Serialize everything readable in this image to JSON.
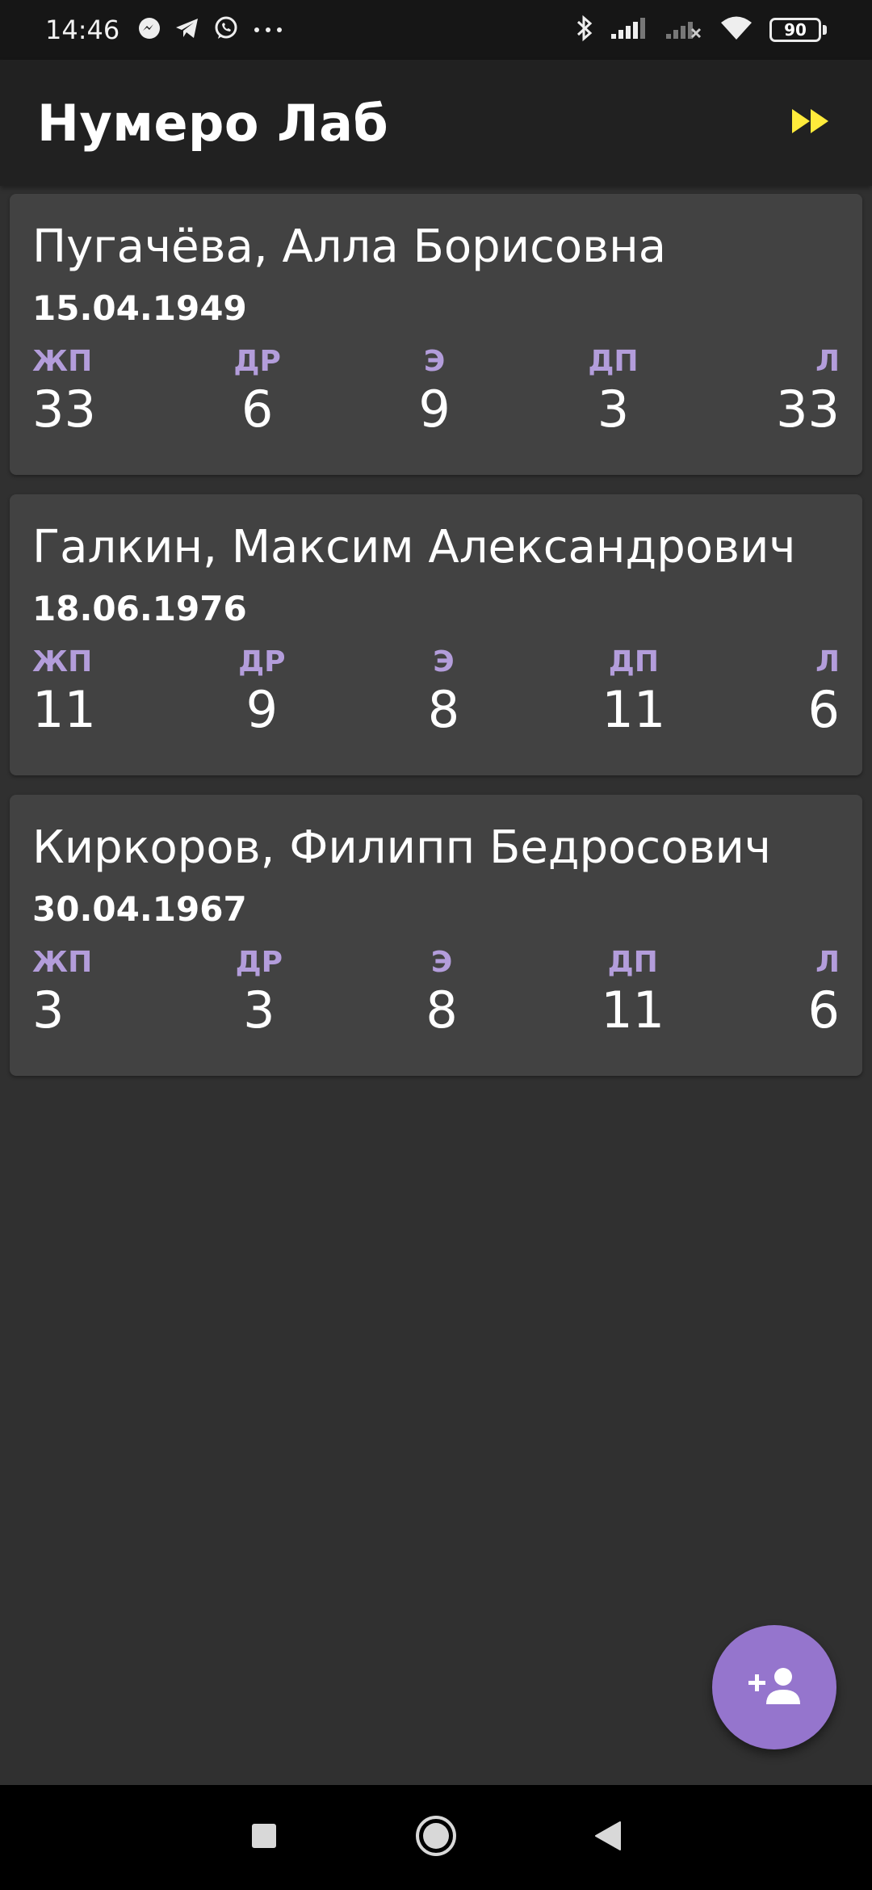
{
  "status_bar": {
    "time": "14:46",
    "battery": "90",
    "icons": [
      "messenger-icon",
      "telegram-icon",
      "whatsapp-icon",
      "more-dots-icon",
      "bluetooth-icon",
      "signal-icon",
      "signal-no-service-icon",
      "wifi-icon",
      "battery-icon"
    ]
  },
  "app_bar": {
    "title": "Нумеро Лаб",
    "action_icon": "fast-forward-icon",
    "action_color": "#ffeb3b"
  },
  "people": [
    {
      "name": "Пугачёва, Алла Борисовна",
      "date": "15.04.1949",
      "metrics": [
        {
          "label": "ЖП",
          "value": "33"
        },
        {
          "label": "ДР",
          "value": "6"
        },
        {
          "label": "Э",
          "value": "9"
        },
        {
          "label": "ДП",
          "value": "3"
        },
        {
          "label": "Л",
          "value": "33"
        }
      ]
    },
    {
      "name": "Галкин, Максим Александрович",
      "date": "18.06.1976",
      "metrics": [
        {
          "label": "ЖП",
          "value": "11"
        },
        {
          "label": "ДР",
          "value": "9"
        },
        {
          "label": "Э",
          "value": "8"
        },
        {
          "label": "ДП",
          "value": "11"
        },
        {
          "label": "Л",
          "value": "6"
        }
      ]
    },
    {
      "name": "Киркоров, Филипп Бедросович",
      "date": "30.04.1967",
      "metrics": [
        {
          "label": "ЖП",
          "value": "3"
        },
        {
          "label": "ДР",
          "value": "3"
        },
        {
          "label": "Э",
          "value": "8"
        },
        {
          "label": "ДП",
          "value": "11"
        },
        {
          "label": "Л",
          "value": "6"
        }
      ]
    }
  ],
  "fab": {
    "icon": "person-add-icon",
    "color": "#9575cd"
  },
  "nav_bar": {
    "icons": [
      "recents-square-icon",
      "home-circle-icon",
      "back-triangle-icon"
    ]
  },
  "colors": {
    "background": "#303030",
    "card": "#424242",
    "label_accent": "#b39ddb"
  }
}
